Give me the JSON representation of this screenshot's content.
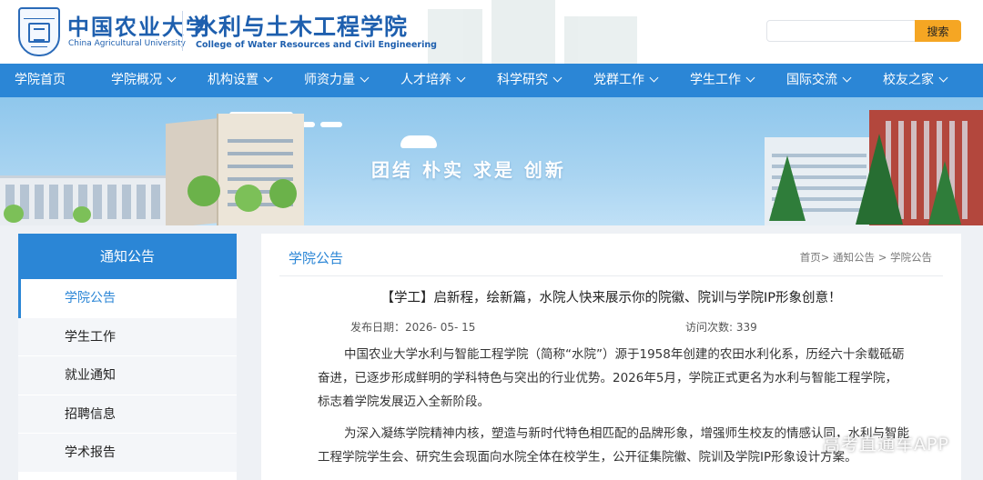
{
  "header": {
    "university_cn": "中国农业大学",
    "university_en": "China Agricultural University",
    "college_cn": "水利与土木工程学院",
    "college_en": "College of Water Resources and Civil Engineering",
    "search_placeholder": "",
    "search_button": "搜索"
  },
  "nav": {
    "items": [
      {
        "label": "学院首页",
        "dropdown": false
      },
      {
        "label": "学院概况",
        "dropdown": true
      },
      {
        "label": "机构设置",
        "dropdown": true
      },
      {
        "label": "师资力量",
        "dropdown": true
      },
      {
        "label": "人才培养",
        "dropdown": true
      },
      {
        "label": "科学研究",
        "dropdown": true
      },
      {
        "label": "党群工作",
        "dropdown": true
      },
      {
        "label": "学生工作",
        "dropdown": true
      },
      {
        "label": "国际交流",
        "dropdown": true
      },
      {
        "label": "校友之家",
        "dropdown": true
      }
    ]
  },
  "banner": {
    "slogan": "团结  朴实  求是  创新"
  },
  "sidebar": {
    "title": "通知公告",
    "items": [
      {
        "label": "学院公告",
        "active": true
      },
      {
        "label": "学生工作",
        "active": false
      },
      {
        "label": "就业通知",
        "active": false
      },
      {
        "label": "招聘信息",
        "active": false
      },
      {
        "label": "学术报告",
        "active": false
      }
    ]
  },
  "main": {
    "section_title": "学院公告",
    "breadcrumb": "首页> 通知公告 > 学院公告",
    "article": {
      "title": "【学工】启新程，绘新篇，水院人快来展示你的院徽、院训与学院IP形象创意！",
      "date_label": "发布日期：",
      "date_value": "2026- 05- 15",
      "visits_label": "访问次数: ",
      "visits_value": "339",
      "paragraphs": [
        "中国农业大学水利与智能工程学院（简称“水院”）源于1958年创建的农田水利化系，历经六十余载砥砺奋进，已逐步形成鲜明的学科特色与突出的行业优势。2026年5月，学院正式更名为水利与智能工程学院，标志着学院发展迈入全新阶段。",
        "为深入凝练学院精神内核，塑造与新时代特色相匹配的品牌形象，增强师生校友的情感认同，水利与智能工程学院学生会、研究生会现面向水院全体在校学生，公开征集院徽、院训及学院IP形象设计方案。"
      ]
    }
  },
  "watermark": "高考直通车APP",
  "colors": {
    "brand_blue": "#2b86d6",
    "logo_blue": "#1e5fae",
    "search_orange": "#f5a623",
    "page_bg": "#eef1f5"
  }
}
